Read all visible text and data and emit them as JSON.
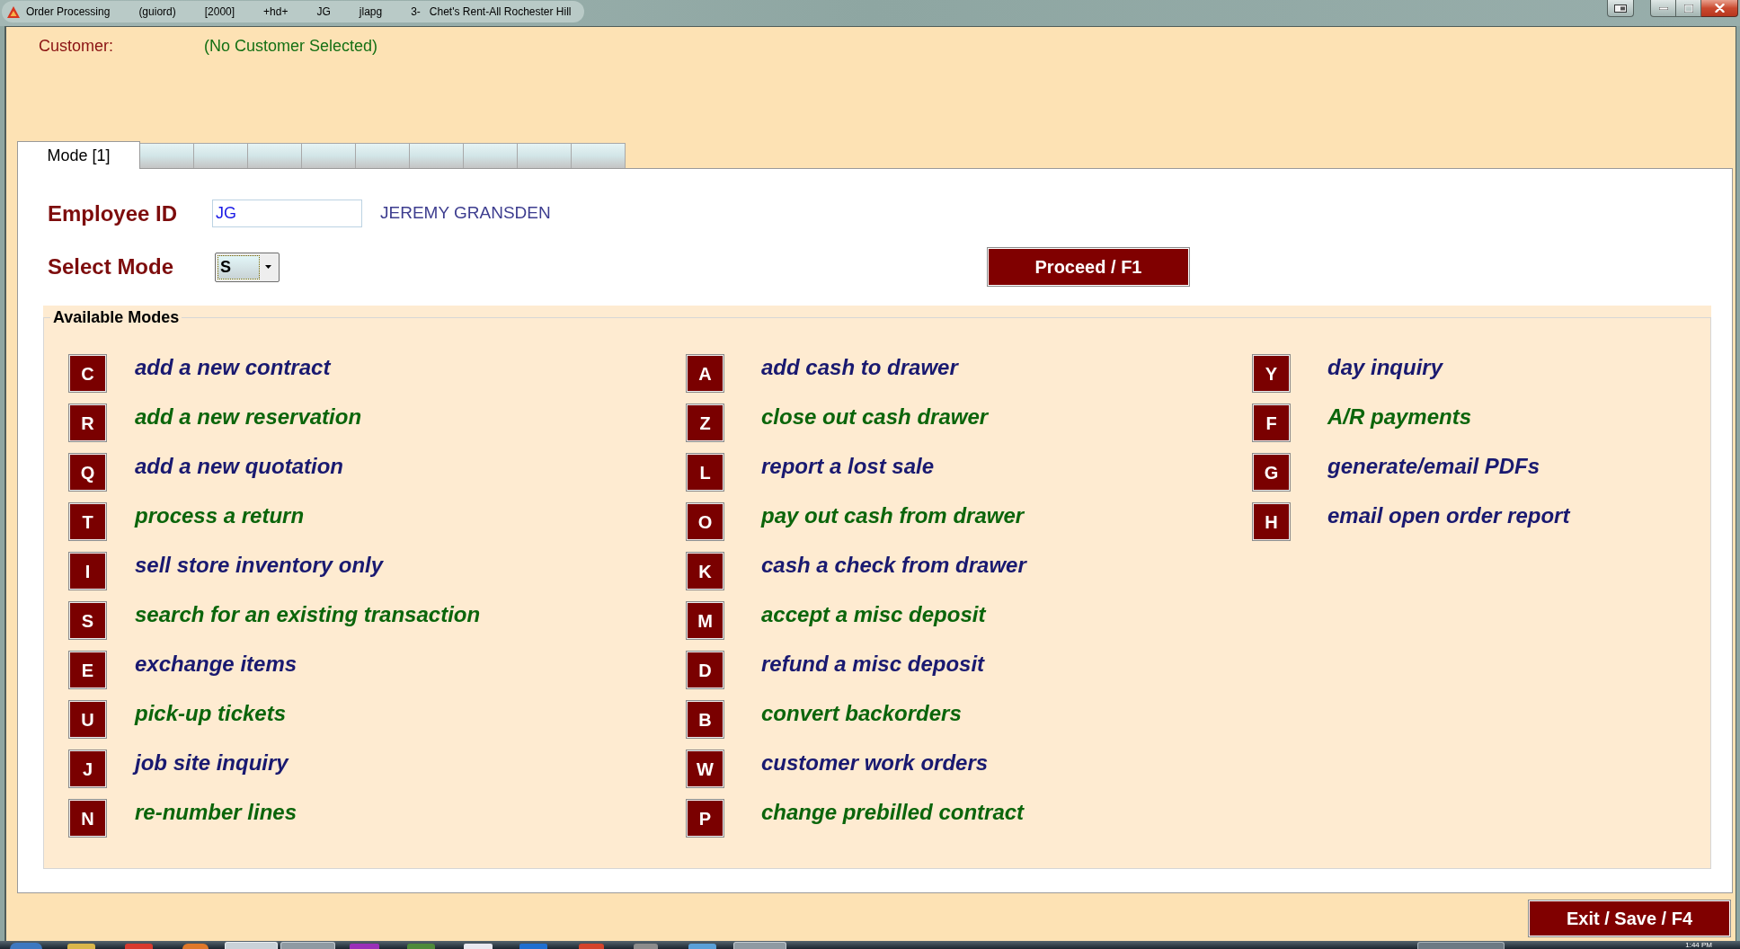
{
  "title_bar": {
    "title": "Order Processing",
    "fields": [
      "(guiord)",
      "[2000]",
      "+hd+",
      "JG",
      "jlapg",
      "3-",
      "Chet's Rent-All Rochester Hill"
    ]
  },
  "customer": {
    "label": "Customer:",
    "value": "(No Customer Selected)"
  },
  "tabs": [
    {
      "label": "Mode [1]",
      "selected": true
    },
    {
      "selected": false
    },
    {
      "selected": false
    },
    {
      "selected": false
    },
    {
      "selected": false
    },
    {
      "selected": false
    },
    {
      "selected": false
    },
    {
      "selected": false
    },
    {
      "selected": false
    },
    {
      "selected": false
    }
  ],
  "employee": {
    "label": "Employee ID",
    "value": "JG",
    "name": "JEREMY GRANSDEN"
  },
  "mode_select": {
    "label": "Select Mode",
    "value": "S"
  },
  "proceed_button": "Proceed / F1",
  "available_modes": {
    "title": "Available Modes",
    "columns": [
      [
        {
          "key": "C",
          "label": "add a new contract",
          "color": "#191970"
        },
        {
          "key": "R",
          "label": "add a new reservation",
          "color": "#0b650b"
        },
        {
          "key": "Q",
          "label": "add a new quotation",
          "color": "#191970"
        },
        {
          "key": "T",
          "label": "process a return",
          "color": "#0b650b"
        },
        {
          "key": "I",
          "label": "sell store inventory only",
          "color": "#191970"
        },
        {
          "key": "S",
          "label": "search for an existing transaction",
          "color": "#0b650b"
        },
        {
          "key": "E",
          "label": "exchange items",
          "color": "#191970"
        },
        {
          "key": "U",
          "label": "pick-up tickets",
          "color": "#0b650b"
        },
        {
          "key": "J",
          "label": "job site inquiry",
          "color": "#191970"
        },
        {
          "key": "N",
          "label": "re-number lines",
          "color": "#0b650b"
        }
      ],
      [
        {
          "key": "A",
          "label": "add cash to drawer",
          "color": "#191970"
        },
        {
          "key": "Z",
          "label": "close out cash drawer",
          "color": "#0b650b"
        },
        {
          "key": "L",
          "label": "report a lost sale",
          "color": "#191970"
        },
        {
          "key": "O",
          "label": "pay out cash from drawer",
          "color": "#0b650b"
        },
        {
          "key": "K",
          "label": "cash a check from drawer",
          "color": "#191970"
        },
        {
          "key": "M",
          "label": "accept a misc deposit",
          "color": "#0b650b"
        },
        {
          "key": "D",
          "label": "refund a misc deposit",
          "color": "#191970"
        },
        {
          "key": "B",
          "label": "convert backorders",
          "color": "#0b650b"
        },
        {
          "key": "W",
          "label": "customer work orders",
          "color": "#191970"
        },
        {
          "key": "P",
          "label": "change prebilled contract",
          "color": "#0b650b"
        }
      ],
      [
        {
          "key": "Y",
          "label": "day inquiry",
          "color": "#191970"
        },
        {
          "key": "F",
          "label": "A/R payments",
          "color": "#0b650b"
        },
        {
          "key": "G",
          "label": "generate/email PDFs",
          "color": "#191970"
        },
        {
          "key": "H",
          "label": "email open order report",
          "color": "#191970"
        }
      ]
    ]
  },
  "exit_button": "Exit / Save / F4",
  "taskbar": {
    "clock": "1:44 PM"
  }
}
